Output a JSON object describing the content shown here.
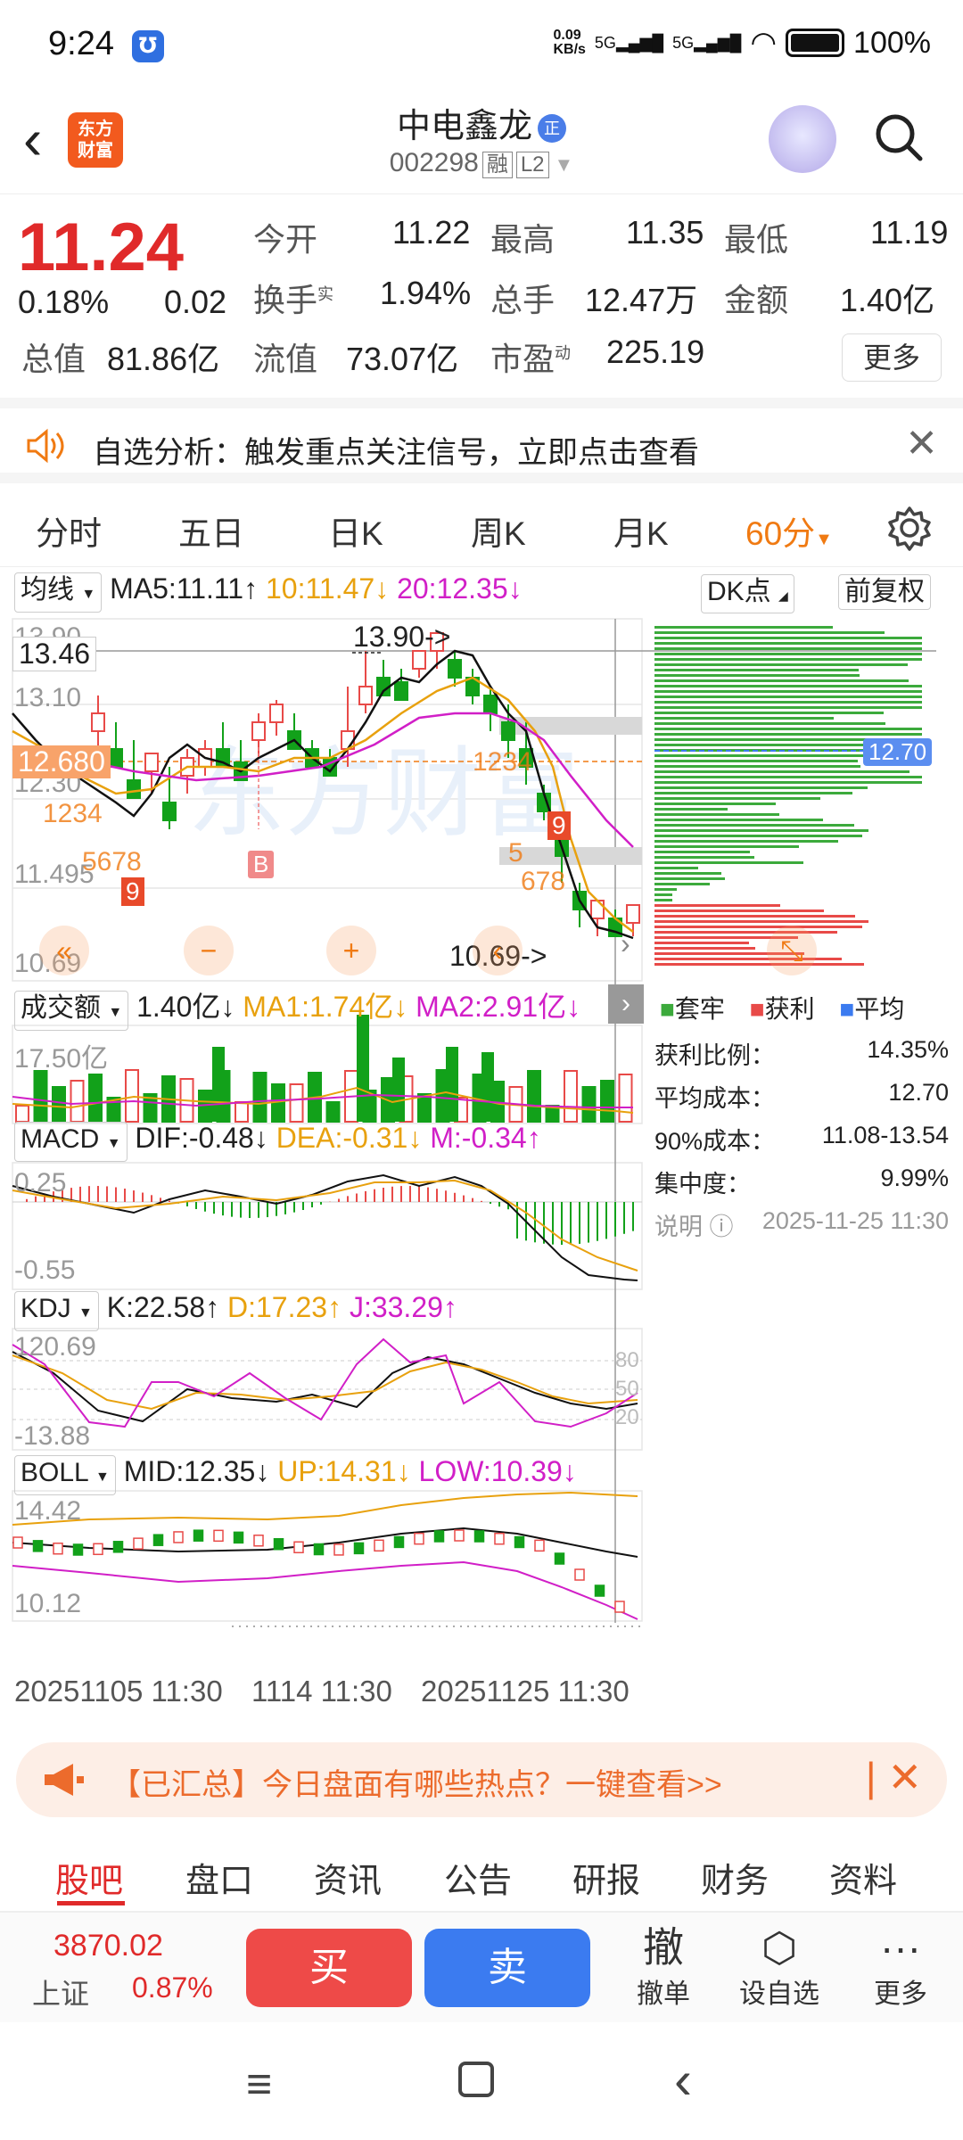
{
  "status": {
    "time": "9:24",
    "net_speed": "0.09\nKB/s",
    "battery": "100%",
    "sig1": "5G",
    "sig2": "5G"
  },
  "header": {
    "logo": "东方\n财富",
    "stock_name": "中电鑫龙",
    "badge": "正",
    "code": "002298",
    "tag1": "融",
    "tag2": "L2"
  },
  "quote": {
    "price": "11.24",
    "change_pct": "0.18%",
    "change": "0.02",
    "open_label": "今开",
    "open": "11.22",
    "high_label": "最高",
    "high": "11.35",
    "low_label": "最低",
    "low": "11.19",
    "turnover_label": "换手",
    "turnover_sup": "实",
    "turnover": "1.94%",
    "volume_label": "总手",
    "volume": "12.47万",
    "amount_label": "金额",
    "amount": "1.40亿",
    "mcap_label": "总值",
    "mcap": "81.86亿",
    "float_label": "流值",
    "float": "73.07亿",
    "pe_label": "市盈",
    "pe_sup": "动",
    "pe": "225.19",
    "more": "更多"
  },
  "notice": {
    "text": "自选分析：触发重点关注信号，立即点击查看"
  },
  "tabs": {
    "t1": "分时",
    "t2": "五日",
    "t3": "日K",
    "t4": "周K",
    "t5": "月K",
    "t6": "60分"
  },
  "ma": {
    "dd": "均线",
    "ma5": "MA5:11.11↑",
    "ma10": "10:11.47↓",
    "ma20": "20:12.35↓",
    "dk": "DK点",
    "fq": "前复权"
  },
  "kchart": {
    "y_top": "13.90",
    "y_mid1": "13.10",
    "y_mid2": "12.30",
    "y_mid3": "11.495",
    "y_bot": "10.69",
    "cursor_price": "13.46",
    "dash_price": "12.680",
    "max_label": "13.90->",
    "min_label": "10.69->",
    "b_mark": "B",
    "n1": "1234",
    "n2": "5678",
    "n3": "9",
    "n4": "1234",
    "n5": "5",
    "n6": "678",
    "n7": "9"
  },
  "chip": {
    "avg_price": "12.70",
    "legend1": "套牢",
    "legend2": "获利",
    "legend3": "平均",
    "r1_label": "获利比例：",
    "r1": "14.35%",
    "r2_label": "平均成本：",
    "r2": "12.70",
    "r3_label": "90%成本：",
    "r3": "11.08-13.54",
    "r4_label": "集中度：",
    "r4": "9.99%",
    "note": "说明",
    "date": "2025-11-25 11:30"
  },
  "vol": {
    "dd": "成交额",
    "v": "1.40亿↓",
    "ma1": "MA1:1.74亿↓",
    "ma2": "MA2:2.91亿↓",
    "ymax": "17.50亿"
  },
  "macd": {
    "dd": "MACD",
    "dif": "DIF:-0.48↓",
    "dea": "DEA:-0.31↓",
    "m": "M:-0.34↑",
    "ytop": "0.25",
    "ybot": "-0.55"
  },
  "kdj": {
    "dd": "KDJ",
    "k": "K:22.58↑",
    "d": "D:17.23↑",
    "j": "J:33.29↑",
    "ytop": "120.69",
    "ybot": "-13.88",
    "l80": "80",
    "l50": "50",
    "l20": "20"
  },
  "boll": {
    "dd": "BOLL",
    "mid": "MID:12.35↓",
    "up": "UP:14.31↓",
    "low": "LOW:10.39↓",
    "ytop": "14.42",
    "ybot": "10.12"
  },
  "xaxis": {
    "a": "20251105 11:30",
    "b": "1114 11:30",
    "c": "20251125 11:30"
  },
  "banner": {
    "text": "【已汇总】今日盘面有哪些热点？一键查看>>"
  },
  "subtabs": {
    "s1": "股吧",
    "s2": "盘口",
    "s3": "资讯",
    "s4": "公告",
    "s5": "研报",
    "s6": "财务",
    "s7": "资料"
  },
  "bottom": {
    "index_val": "3870.02",
    "index_name": "上证",
    "index_pct": "0.87%",
    "buy": "买",
    "sell": "卖",
    "cancel_glyph": "撤",
    "cancel": "撤单",
    "fav": "设自选",
    "more": "更多"
  }
}
